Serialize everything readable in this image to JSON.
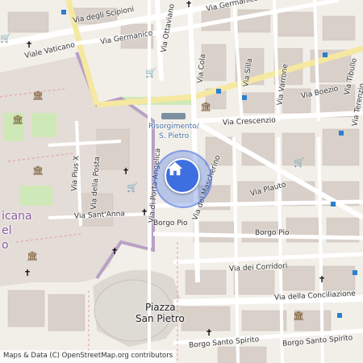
{
  "map": {
    "labels": {
      "via_degli_scipioni": "Via degli Scipioni",
      "viale_vaticano": "Viale Vaticano",
      "via_germanico_1": "Via Germanico",
      "via_germanico_2": "Via Germanico",
      "via_ottaviano": "Via Ottaviano",
      "via_cola": "Via Cola",
      "via_silla": "Via Silla",
      "via_varrone": "Via Varrone",
      "via_boezio": "Via Boezio",
      "via_tibullo": "Via Tibullo",
      "via_terenzio": "Via Terenzio",
      "via_crescenzio": "Via Crescenzio",
      "risorgimento": "Risorgimento/",
      "s_pietro": "S. Pietro",
      "via_pius_x": "Via Pius X",
      "via_della_posta": "Via della Posta",
      "via_sant_anna": "Via Sant'Anna",
      "via_di_porta_angelica": "Via di Porta Angelica",
      "via_dei_mascherino": "Via del Mascherino",
      "via_plauto": "Via Plauto",
      "borgo_pio_1": "Borgo Pio",
      "borgo_pio_2": "Borgo Pio",
      "via_dei_corridori": "Via dei Corridori",
      "via_della_conciliazione": "Via della Conciliazione",
      "borgo_santo_spirito_1": "Borgo Santo Spirito",
      "borgo_santo_spirito_2": "Borgo Santo Spirito",
      "piazza_1": "Piazza",
      "piazza_2": "San Pietro",
      "vaticana_1": "icana",
      "vaticana_2": "el",
      "vaticana_3": "o"
    },
    "marker": {
      "icon": "home-icon",
      "color": "#3d6fe0"
    },
    "attribution": "Maps & Data (C) OpenStreetMap.org contributors"
  }
}
